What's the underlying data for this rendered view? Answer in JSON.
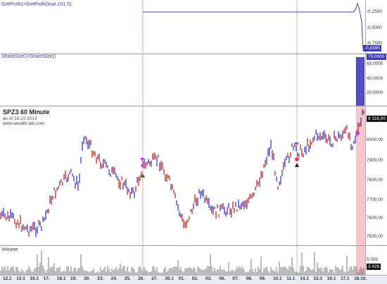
{
  "panes": {
    "profit": {
      "label": "GetProfit1=GetProfit(true,101.5)",
      "ticks": [
        "-0,2500",
        "-0,5000",
        "-0,7500"
      ],
      "last": "-0,8395"
    },
    "sharesize": {
      "label": "ShareSize1=ShareSize()",
      "ticks": [
        "60,0000",
        "40,0000",
        "20,0000"
      ],
      "last": "70,0000"
    },
    "price": {
      "title": "SPZ3 60 Minute",
      "asof": "as of 18.10.2013",
      "site": "www.wealth-lab.com",
      "ticks": [
        "8000,00",
        "7900,00",
        "7800,00",
        "7700,00",
        "7600,00",
        "7500,00"
      ],
      "last": "8 118,00"
    },
    "volume": {
      "label": "Volume",
      "ticks": [
        "5 000"
      ],
      "last": "3 426"
    }
  },
  "dates": [
    "12.1",
    "13.1",
    "16.1",
    "17.",
    "18.1",
    "19.",
    "20.",
    "23.",
    "24.",
    "25.",
    "26.",
    "27.",
    "30.1",
    "01.",
    "02.",
    "03.",
    "06.",
    "07.",
    "08.",
    "09.",
    "10.1",
    "11.1",
    "14.1",
    "15.1",
    "16.1",
    "17.1",
    "18.10."
  ],
  "colors": {
    "up": "#2828c8",
    "down": "#b01818",
    "highlight": "#f6c8cc",
    "accent": "#4040c0",
    "green": "#9adf9a",
    "red": "#f2a0a8"
  }
}
